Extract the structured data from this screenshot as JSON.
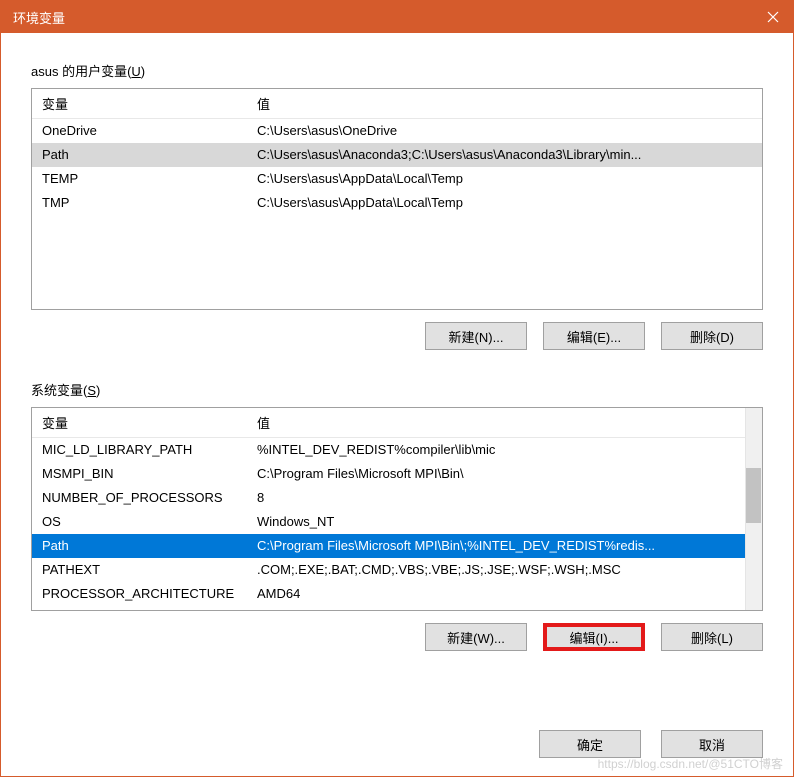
{
  "window": {
    "title": "环境变量"
  },
  "user_section": {
    "label_prefix": "asus 的用户变量(",
    "label_key": "U",
    "label_suffix": ")",
    "headers": {
      "var": "变量",
      "val": "值"
    },
    "rows": [
      {
        "var": "OneDrive",
        "val": "C:\\Users\\asus\\OneDrive"
      },
      {
        "var": "Path",
        "val": "C:\\Users\\asus\\Anaconda3;C:\\Users\\asus\\Anaconda3\\Library\\min..."
      },
      {
        "var": "TEMP",
        "val": "C:\\Users\\asus\\AppData\\Local\\Temp"
      },
      {
        "var": "TMP",
        "val": "C:\\Users\\asus\\AppData\\Local\\Temp"
      }
    ],
    "buttons": {
      "new": "新建(N)...",
      "edit": "编辑(E)...",
      "delete": "删除(D)"
    }
  },
  "sys_section": {
    "label_prefix": "系统变量(",
    "label_key": "S",
    "label_suffix": ")",
    "headers": {
      "var": "变量",
      "val": "值"
    },
    "rows": [
      {
        "var": "MIC_LD_LIBRARY_PATH",
        "val": "%INTEL_DEV_REDIST%compiler\\lib\\mic"
      },
      {
        "var": "MSMPI_BIN",
        "val": "C:\\Program Files\\Microsoft MPI\\Bin\\"
      },
      {
        "var": "NUMBER_OF_PROCESSORS",
        "val": "8"
      },
      {
        "var": "OS",
        "val": "Windows_NT"
      },
      {
        "var": "Path",
        "val": "C:\\Program Files\\Microsoft MPI\\Bin\\;%INTEL_DEV_REDIST%redis..."
      },
      {
        "var": "PATHEXT",
        "val": ".COM;.EXE;.BAT;.CMD;.VBS;.VBE;.JS;.JSE;.WSF;.WSH;.MSC"
      },
      {
        "var": "PROCESSOR_ARCHITECTURE",
        "val": "AMD64"
      }
    ],
    "buttons": {
      "new": "新建(W)...",
      "edit": "编辑(I)...",
      "delete": "删除(L)"
    }
  },
  "footer": {
    "ok": "确定",
    "cancel": "取消"
  },
  "watermark": "https://blog.csdn.net/@51CTO博客"
}
